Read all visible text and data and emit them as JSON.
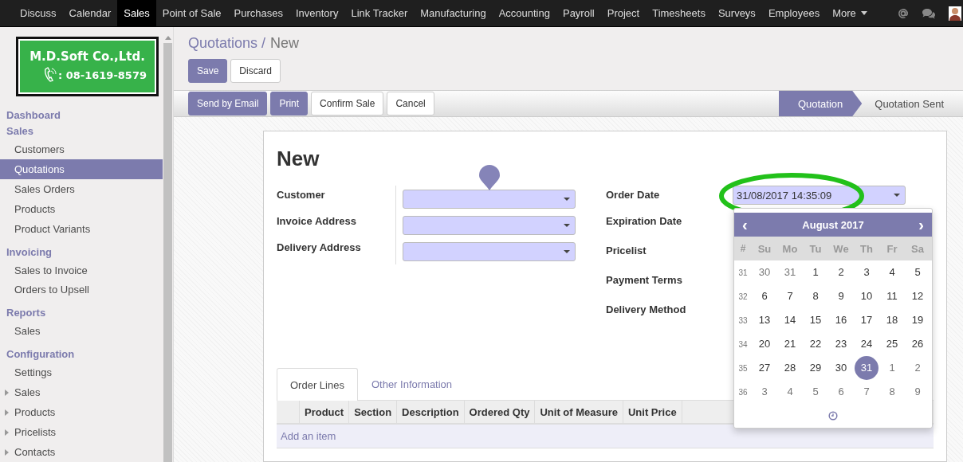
{
  "navbar": {
    "items": [
      {
        "label": "Discuss",
        "selected": false
      },
      {
        "label": "Calendar",
        "selected": false
      },
      {
        "label": "Sales",
        "selected": true
      },
      {
        "label": "Point of Sale",
        "selected": false
      },
      {
        "label": "Purchases",
        "selected": false
      },
      {
        "label": "Inventory",
        "selected": false
      },
      {
        "label": "Link Tracker",
        "selected": false
      },
      {
        "label": "Manufacturing",
        "selected": false
      },
      {
        "label": "Accounting",
        "selected": false
      },
      {
        "label": "Payroll",
        "selected": false
      },
      {
        "label": "Project",
        "selected": false
      },
      {
        "label": "Timesheets",
        "selected": false
      },
      {
        "label": "Surveys",
        "selected": false
      },
      {
        "label": "Employees",
        "selected": false
      }
    ],
    "more": "More"
  },
  "logo": {
    "company": "M.D.Soft Co.,Ltd.",
    "phone": ": 08-1619-8579"
  },
  "sidebar": {
    "sections": [
      {
        "title": "Dashboard"
      },
      {
        "title": "Sales",
        "items": [
          {
            "label": "Customers",
            "selected": false,
            "has_children": false
          },
          {
            "label": "Quotations",
            "selected": true,
            "has_children": false
          },
          {
            "label": "Sales Orders",
            "selected": false,
            "has_children": false
          },
          {
            "label": "Products",
            "selected": false,
            "has_children": false
          },
          {
            "label": "Product Variants",
            "selected": false,
            "has_children": false
          }
        ]
      },
      {
        "title": "Invoicing",
        "items": [
          {
            "label": "Sales to Invoice",
            "selected": false,
            "has_children": false
          },
          {
            "label": "Orders to Upsell",
            "selected": false,
            "has_children": false
          }
        ]
      },
      {
        "title": "Reports",
        "items": [
          {
            "label": "Sales",
            "selected": false,
            "has_children": false
          }
        ]
      },
      {
        "title": "Configuration",
        "items": [
          {
            "label": "Settings",
            "selected": false,
            "has_children": false
          },
          {
            "label": "Sales",
            "selected": false,
            "has_children": true
          },
          {
            "label": "Products",
            "selected": false,
            "has_children": true
          },
          {
            "label": "Pricelists",
            "selected": false,
            "has_children": true
          },
          {
            "label": "Contacts",
            "selected": false,
            "has_children": true
          }
        ]
      }
    ]
  },
  "breadcrumb": {
    "parent": "Quotations /",
    "current": "New"
  },
  "buttons": [
    {
      "label": "Save",
      "kind": "primary"
    },
    {
      "label": "Discard",
      "kind": "default"
    }
  ],
  "actions": [
    {
      "label": "Send by Email",
      "kind": "primary"
    },
    {
      "label": "Print",
      "kind": "primary"
    },
    {
      "label": "Confirm Sale",
      "kind": "default"
    },
    {
      "label": "Cancel",
      "kind": "default"
    }
  ],
  "status_steps": [
    {
      "label": "Quotation",
      "selected": true
    },
    {
      "label": "Quotation Sent",
      "selected": false
    }
  ],
  "form": {
    "title": "New",
    "left_fields": [
      {
        "label": "Customer"
      },
      {
        "label": "Invoice Address"
      },
      {
        "label": "Delivery Address"
      }
    ],
    "right_fields": [
      {
        "label": "Order Date",
        "value": "31/08/2017 14:35:09"
      },
      {
        "label": "Expiration Date"
      },
      {
        "label": "Pricelist"
      },
      {
        "label": "Payment Terms"
      },
      {
        "label": "Delivery Method"
      }
    ],
    "tabs": [
      {
        "label": "Order Lines",
        "selected": true
      },
      {
        "label": "Other Information",
        "selected": false
      }
    ],
    "table": {
      "columns": [
        "Product",
        "Section",
        "Description",
        "Ordered Qty",
        "Unit of Measure",
        "Unit Price"
      ],
      "add_item": "Add an item"
    }
  },
  "datepicker": {
    "prev": "‹",
    "next": "›",
    "month": "August 2017",
    "week_header": "#",
    "weekdays": [
      "Su",
      "Mo",
      "Tu",
      "We",
      "Th",
      "Fr",
      "Sa"
    ],
    "weeks": [
      {
        "number": "31",
        "days": [
          {
            "day": "30",
            "other_month": true,
            "selected": false
          },
          {
            "day": "31",
            "other_month": true,
            "selected": false
          },
          {
            "day": "1",
            "other_month": false,
            "selected": false
          },
          {
            "day": "2",
            "other_month": false,
            "selected": false
          },
          {
            "day": "3",
            "other_month": false,
            "selected": false
          },
          {
            "day": "4",
            "other_month": false,
            "selected": false
          },
          {
            "day": "5",
            "other_month": false,
            "selected": false
          }
        ]
      },
      {
        "number": "32",
        "days": [
          {
            "day": "6",
            "other_month": false,
            "selected": false
          },
          {
            "day": "7",
            "other_month": false,
            "selected": false
          },
          {
            "day": "8",
            "other_month": false,
            "selected": false
          },
          {
            "day": "9",
            "other_month": false,
            "selected": false
          },
          {
            "day": "10",
            "other_month": false,
            "selected": false
          },
          {
            "day": "11",
            "other_month": false,
            "selected": false
          },
          {
            "day": "12",
            "other_month": false,
            "selected": false
          }
        ]
      },
      {
        "number": "33",
        "days": [
          {
            "day": "13",
            "other_month": false,
            "selected": false
          },
          {
            "day": "14",
            "other_month": false,
            "selected": false
          },
          {
            "day": "15",
            "other_month": false,
            "selected": false
          },
          {
            "day": "16",
            "other_month": false,
            "selected": false
          },
          {
            "day": "17",
            "other_month": false,
            "selected": false
          },
          {
            "day": "18",
            "other_month": false,
            "selected": false
          },
          {
            "day": "19",
            "other_month": false,
            "selected": false
          }
        ]
      },
      {
        "number": "34",
        "days": [
          {
            "day": "20",
            "other_month": false,
            "selected": false
          },
          {
            "day": "21",
            "other_month": false,
            "selected": false
          },
          {
            "day": "22",
            "other_month": false,
            "selected": false
          },
          {
            "day": "23",
            "other_month": false,
            "selected": false
          },
          {
            "day": "24",
            "other_month": false,
            "selected": false
          },
          {
            "day": "25",
            "other_month": false,
            "selected": false
          },
          {
            "day": "26",
            "other_month": false,
            "selected": false
          }
        ]
      },
      {
        "number": "35",
        "days": [
          {
            "day": "27",
            "other_month": false,
            "selected": false
          },
          {
            "day": "28",
            "other_month": false,
            "selected": false
          },
          {
            "day": "29",
            "other_month": false,
            "selected": false
          },
          {
            "day": "30",
            "other_month": false,
            "selected": false
          },
          {
            "day": "31",
            "other_month": false,
            "selected": true
          },
          {
            "day": "1",
            "other_month": true,
            "selected": false
          },
          {
            "day": "2",
            "other_month": true,
            "selected": false
          }
        ]
      },
      {
        "number": "36",
        "days": [
          {
            "day": "3",
            "other_month": true,
            "selected": false
          },
          {
            "day": "4",
            "other_month": true,
            "selected": false
          },
          {
            "day": "5",
            "other_month": true,
            "selected": false
          },
          {
            "day": "6",
            "other_month": true,
            "selected": false
          },
          {
            "day": "7",
            "other_month": true,
            "selected": false
          },
          {
            "day": "8",
            "other_month": true,
            "selected": false
          },
          {
            "day": "9",
            "other_month": true,
            "selected": false
          }
        ]
      }
    ]
  }
}
